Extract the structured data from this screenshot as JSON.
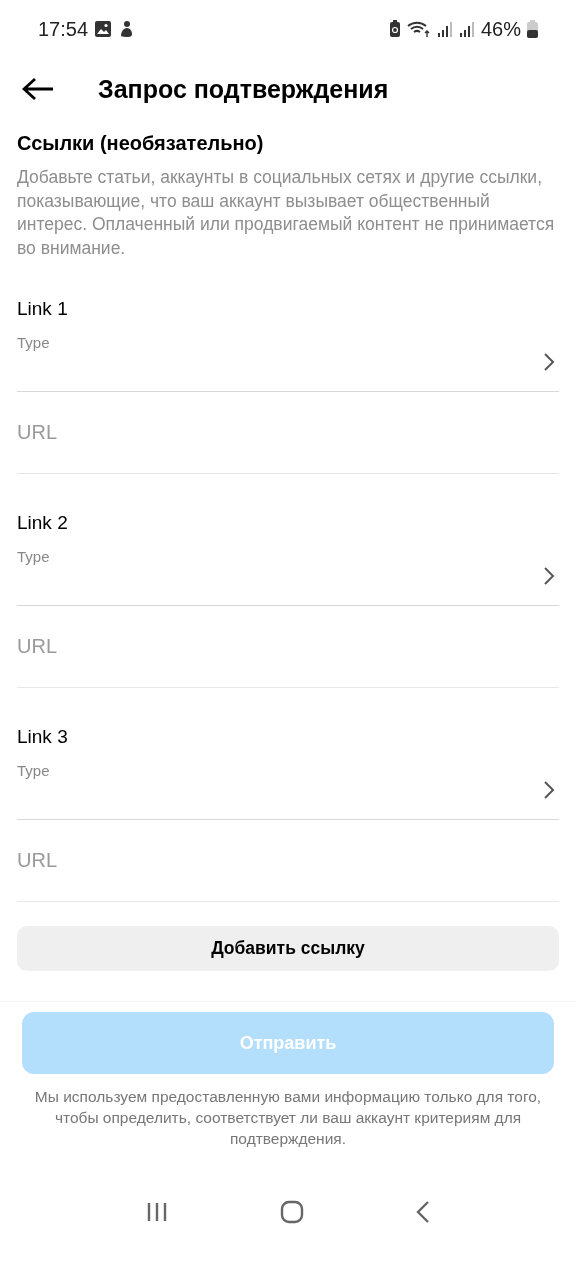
{
  "status_bar": {
    "time": "17:54",
    "battery": "46%"
  },
  "header": {
    "title": "Запрос подтверждения"
  },
  "section": {
    "title": "Ссылки (необязательно)",
    "description": "Добавьте статьи, аккаунты в социальных сетях и другие ссылки, показывающие, что ваш аккаунт вызывает общественный интерес. Оплаченный или продвигаемый контент не принимается во внимание."
  },
  "links": [
    {
      "label": "Link 1",
      "type_placeholder": "Type",
      "url_placeholder": "URL"
    },
    {
      "label": "Link 2",
      "type_placeholder": "Type",
      "url_placeholder": "URL"
    },
    {
      "label": "Link 3",
      "type_placeholder": "Type",
      "url_placeholder": "URL"
    }
  ],
  "add_button": "Добавить ссылку",
  "submit_button": {
    "label": "Отправить",
    "disabled": true
  },
  "footer_note": "Мы используем предоставленную вами информацию только для того, чтобы определить, соответствует ли ваш аккаунт критериям для подтверждения."
}
